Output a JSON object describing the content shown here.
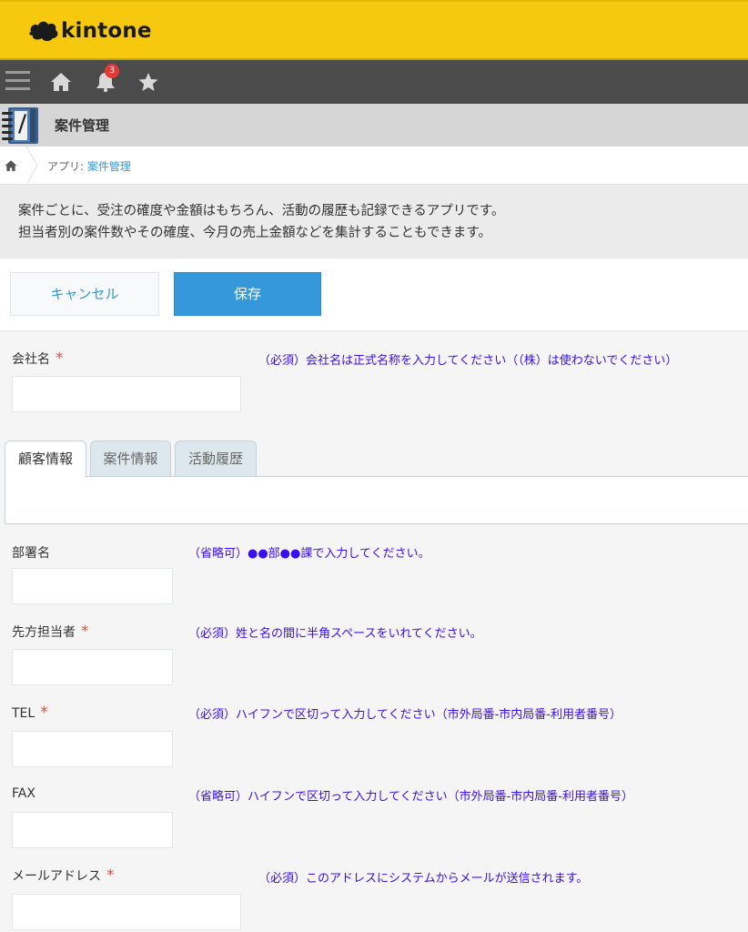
{
  "header": {
    "logo_text": "kintone",
    "notification_count": "3"
  },
  "app": {
    "title": "案件管理"
  },
  "breadcrumb": {
    "prefix": "アプリ: ",
    "current": "案件管理"
  },
  "description": {
    "line1": "案件ごとに、受注の確度や金額はもちろん、活動の履歴も記録できるアプリです。",
    "line2": "担当者別の案件数やその確度、今月の売上金額などを集計することもできます。"
  },
  "actions": {
    "cancel_label": "キャンセル",
    "save_label": "保存"
  },
  "fields": {
    "company": {
      "label": "会社名",
      "required": "*",
      "hint": "（必須）会社名は正式名称を入力してください（（株）は使わないでください）",
      "value": ""
    },
    "department": {
      "label": "部署名",
      "hint": "（省略可）●●部●●課で入力してください。",
      "value": ""
    },
    "contact": {
      "label": "先方担当者",
      "required": "*",
      "hint": "（必須）姓と名の間に半角スペースをいれてください。",
      "value": ""
    },
    "tel": {
      "label": "TEL",
      "required": "*",
      "hint": "（必須）ハイフンで区切って入力してください（市外局番-市内局番-利用者番号）",
      "value": ""
    },
    "fax": {
      "label": "FAX",
      "hint": "（省略可）ハイフンで区切って入力してください（市外局番-市内局番-利用者番号）",
      "value": ""
    },
    "email": {
      "label": "メールアドレス",
      "required": "*",
      "hint": "（必須）このアドレスにシステムからメールが送信されます。",
      "value": ""
    }
  },
  "tabs": [
    "顧客情報",
    "案件情報",
    "活動履歴"
  ],
  "colors": {
    "header_yellow": "#f7c90e",
    "nav_dark": "#4b4b4b",
    "accent_blue": "#3498db",
    "required_red": "#e74c3c",
    "hint_purple": "#3a0ef2"
  },
  "icons": [
    "kintone-logo-icon",
    "menu-icon",
    "home-icon",
    "bell-icon",
    "star-icon",
    "app-notebook-icon",
    "breadcrumb-home-icon"
  ]
}
